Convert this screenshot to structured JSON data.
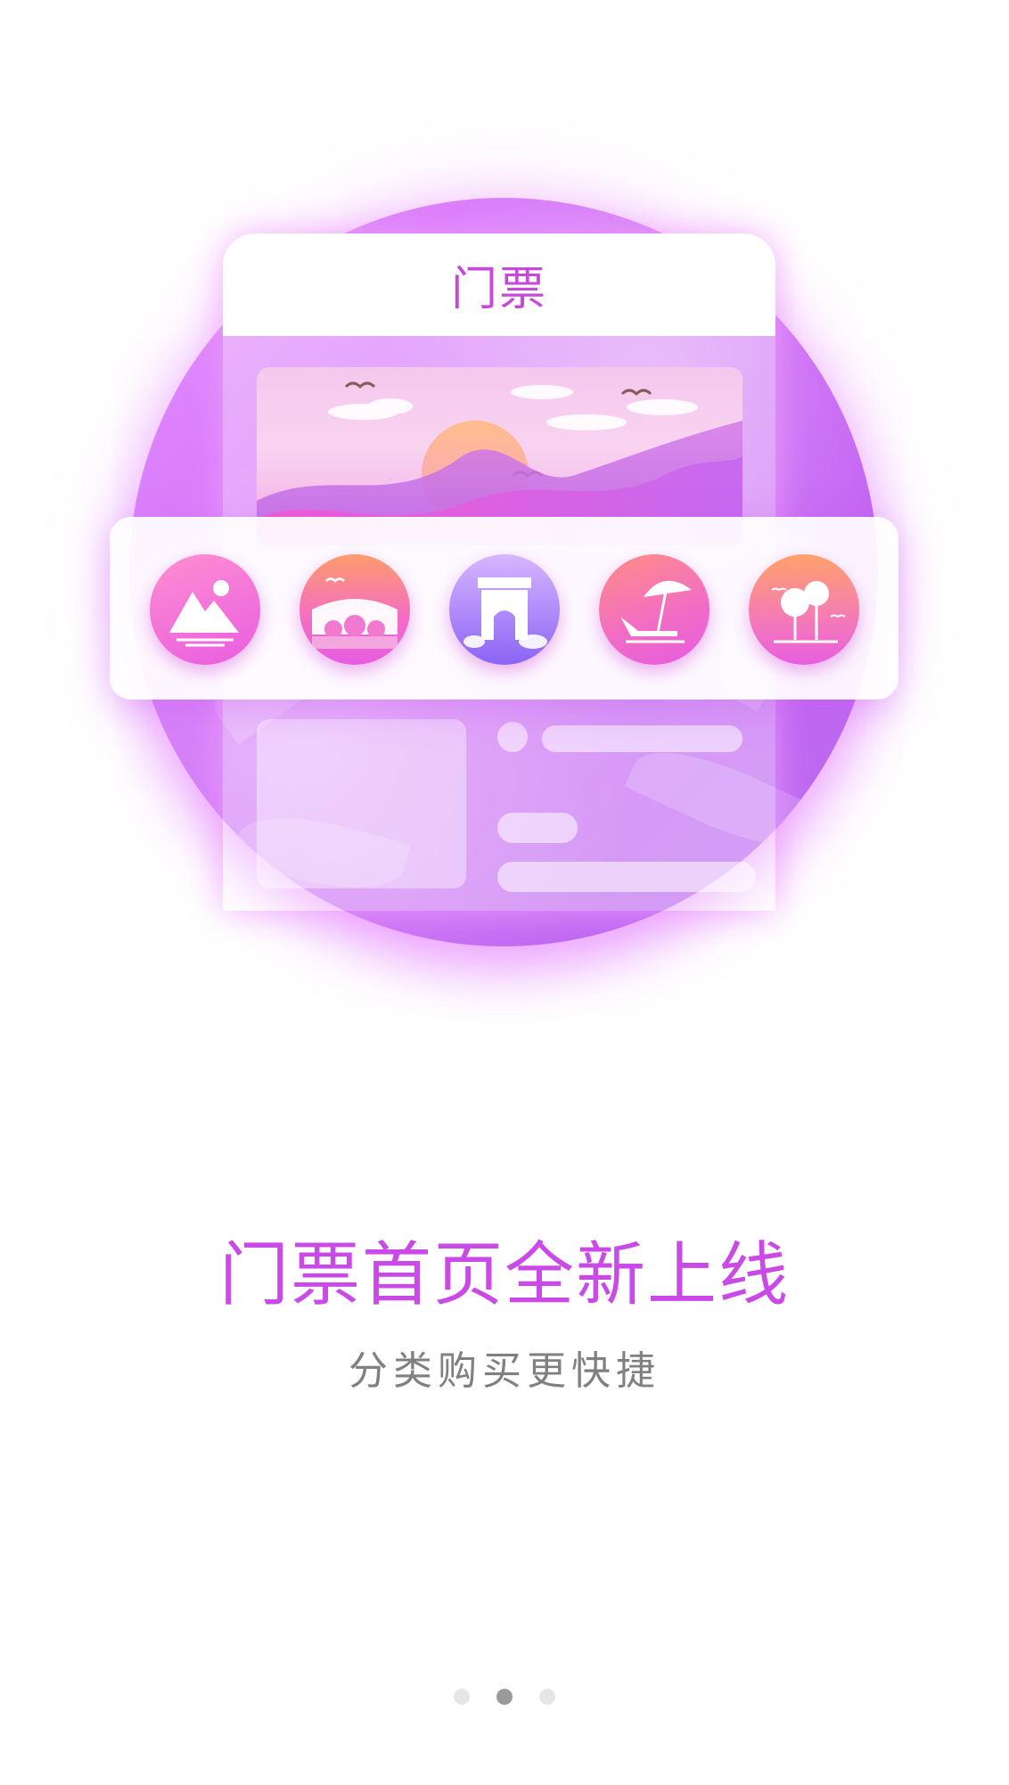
{
  "card": {
    "title": "门票",
    "categories": [
      {
        "icon": "mountain-icon"
      },
      {
        "icon": "bridge-icon"
      },
      {
        "icon": "arch-icon"
      },
      {
        "icon": "beach-umbrella-icon"
      },
      {
        "icon": "trees-icon"
      }
    ]
  },
  "headline": "门票首页全新上线",
  "subline": "分类购买更快捷",
  "pagination": {
    "total": 3,
    "active": 2
  },
  "colors": {
    "accent": "#c94ae6",
    "subtext": "#808080"
  }
}
